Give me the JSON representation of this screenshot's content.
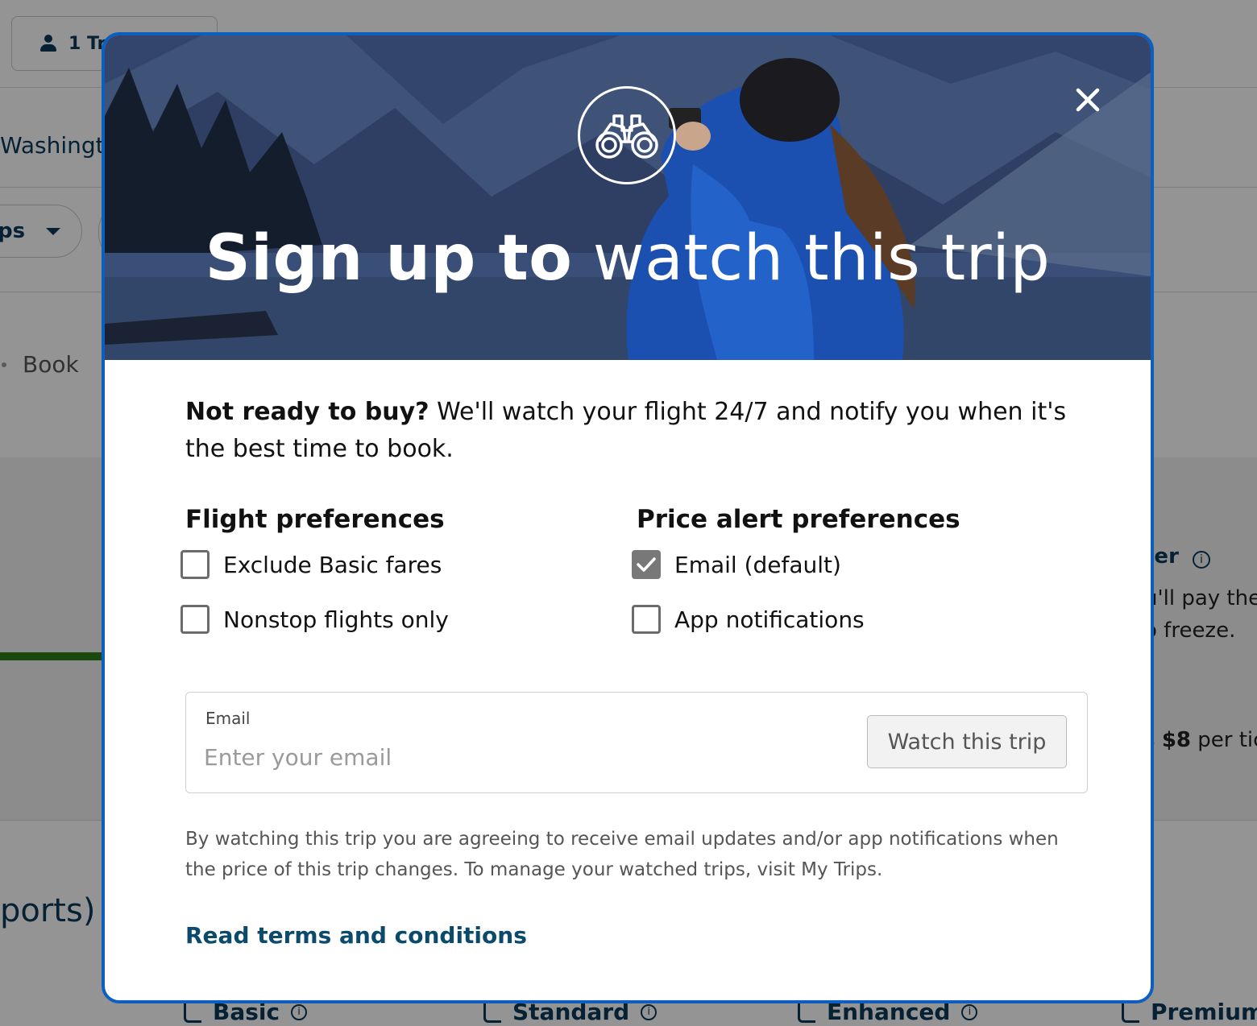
{
  "background": {
    "traveler_label": "1 Tr",
    "destination": "Washingto",
    "filter_pill": "ps",
    "breadcrumb_book": "Book",
    "side_title": "ter",
    "side_line1": "u'll pay the",
    "side_line2": "o freeze.",
    "side_price_prefix": "s ",
    "side_price": "$8",
    "side_price_suffix": " per tic",
    "airports_text": "ports)",
    "fares": [
      "Basic",
      "Standard",
      "Enhanced",
      "Premium"
    ]
  },
  "modal": {
    "title_strong": "Sign up to",
    "title_light": "watch this trip",
    "icon": "binoculars-icon",
    "intro_bold": "Not ready to buy?",
    "intro_rest": " We'll watch your flight 24/7 and notify you when it's the best time to book.",
    "flight_prefs": {
      "heading": "Flight preferences",
      "options": [
        {
          "label": "Exclude Basic fares",
          "checked": false
        },
        {
          "label": "Nonstop flights only",
          "checked": false
        }
      ]
    },
    "alert_prefs": {
      "heading": "Price alert preferences",
      "options": [
        {
          "label": "Email (default)",
          "checked": true
        },
        {
          "label": "App notifications",
          "checked": false
        }
      ]
    },
    "email": {
      "label": "Email",
      "placeholder": "Enter your email",
      "value": ""
    },
    "watch_button": "Watch this trip",
    "disclaimer": "By watching this trip you are agreeing to receive email updates and/or app notifications when the price of this trip changes. To manage your watched trips, visit My Trips.",
    "terms_link": "Read terms and conditions"
  },
  "colors": {
    "modal_border": "#0d5fbf",
    "link": "#0b4a6b",
    "checked_box": "#787878"
  }
}
